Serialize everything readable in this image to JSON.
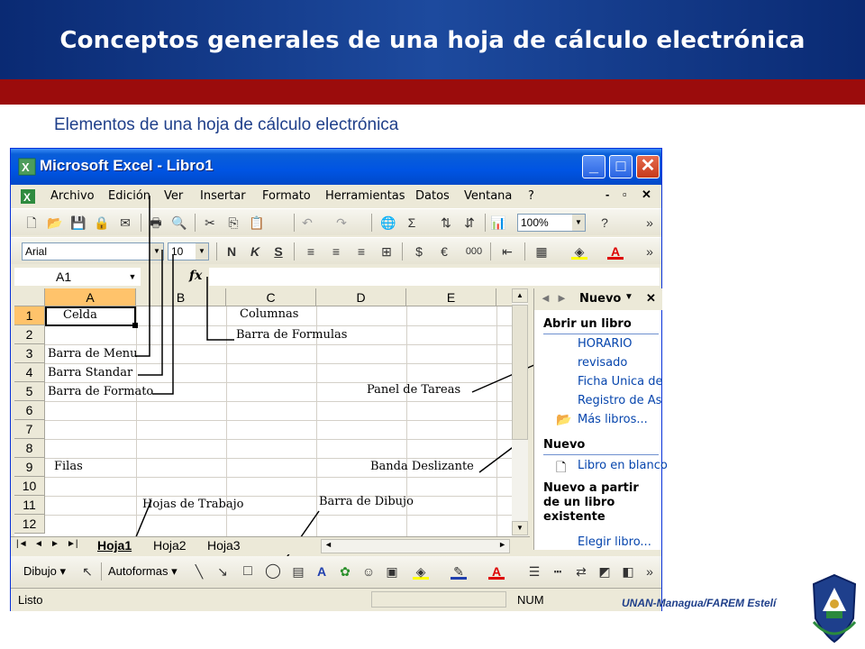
{
  "slide": {
    "title": "Conceptos generales de una hoja de cálculo electrónica",
    "subtitle": "Elementos de una hoja de cálculo electrónica",
    "footer": "UNAN-Managua/FAREM Estelí"
  },
  "window": {
    "title": "Microsoft Excel - Libro1",
    "min_label": "_",
    "max_label": "□",
    "close_label": "✕"
  },
  "menu": {
    "items": [
      "Archivo",
      "Edición",
      "Ver",
      "Insertar",
      "Formato",
      "Herramientas",
      "Datos",
      "Ventana",
      "?"
    ],
    "mdi": [
      "-",
      "▫",
      "✕"
    ]
  },
  "standard_toolbar": {
    "zoom": "100%"
  },
  "format_toolbar": {
    "font": "Arial",
    "size": "10",
    "bold": "N",
    "italic": "K",
    "underline": "S",
    "currency": "€",
    "thousands": "000"
  },
  "formula_bar": {
    "cell_ref": "A1",
    "fx": "fx"
  },
  "grid": {
    "columns": [
      "A",
      "B",
      "C",
      "D",
      "E"
    ],
    "rows": [
      "1",
      "2",
      "3",
      "4",
      "5",
      "6",
      "7",
      "8",
      "9",
      "10",
      "11",
      "12"
    ]
  },
  "annotations": {
    "celda": "Celda",
    "columnas": "Columnas",
    "barra_formulas": "Barra de Formulas",
    "barra_menu": "Barra de Menu",
    "barra_standar": "Barra Standar",
    "barra_formato": "Barra de Formato",
    "panel_tareas": "Panel de Tareas",
    "filas": "Filas",
    "banda_deslizante": "Banda Deslizante",
    "hojas_trabajo": "Hojas de Trabajo",
    "barra_dibujo": "Barra de Dibujo"
  },
  "task_pane": {
    "title": "Nuevo",
    "open_section": "Abrir un libro",
    "recent": [
      "HORARIO",
      "revisado",
      "Ficha Unica de",
      "Registro de As"
    ],
    "more_books": "Más libros...",
    "new_section": "Nuevo",
    "blank_book": "Libro en blanco",
    "from_existing": "Nuevo a partir de un libro existente",
    "choose_book": "Elegir libro..."
  },
  "sheets": {
    "tabs": [
      "Hoja1",
      "Hoja2",
      "Hoja3"
    ],
    "active": "Hoja1"
  },
  "drawing_toolbar": {
    "dibujo": "Dibujo",
    "autoformas": "Autoformas"
  },
  "status": {
    "ready": "Listo",
    "num": "NUM"
  },
  "colors": {
    "header_blue": "#1d4a9e",
    "band_red": "#9b0c0c",
    "subtitle_blue": "#1f3f8a",
    "xp_title": "#0054e3",
    "selection": "#ffc36b"
  }
}
